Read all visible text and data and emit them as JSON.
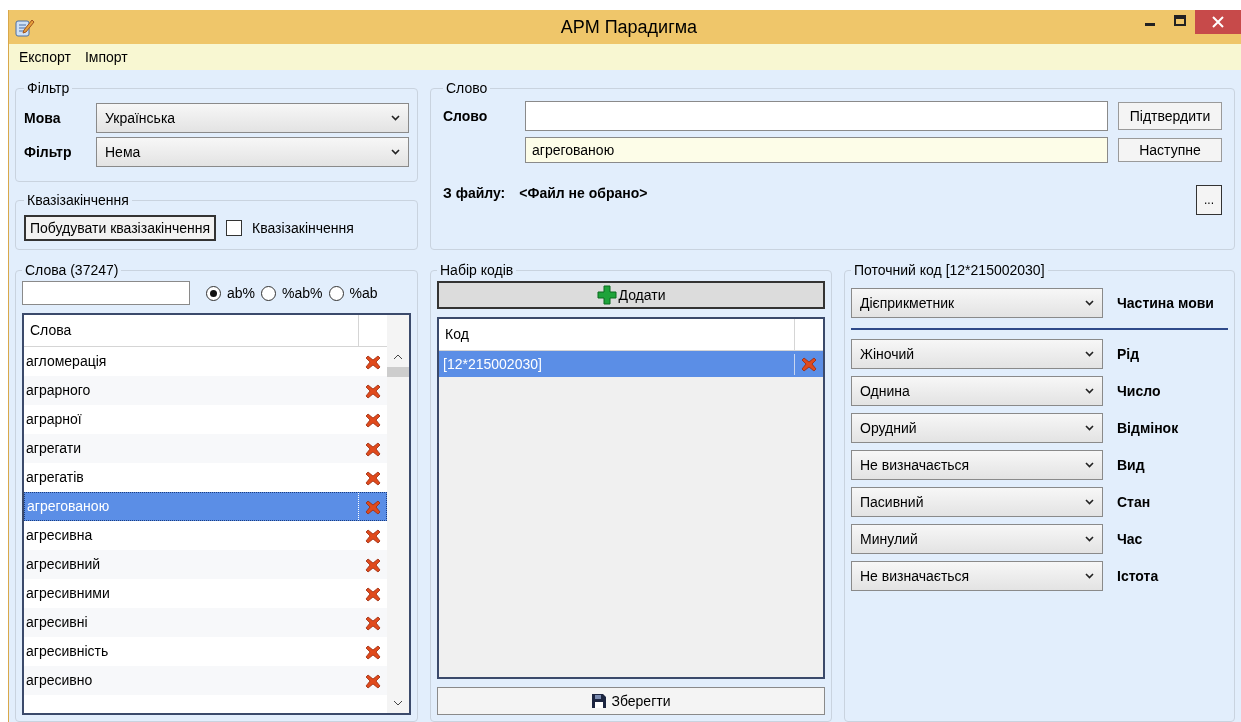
{
  "window": {
    "title": "АРМ Парадигма"
  },
  "menu": [
    "Експорт",
    "Імпорт"
  ],
  "filter_group": {
    "title": "Фільтр",
    "fields": [
      {
        "label": "Мова",
        "value": "Українська"
      },
      {
        "label": "Фільтр",
        "value": "Нема"
      }
    ]
  },
  "quasi_group": {
    "title": "Квазізакінчення",
    "button": "Побудувати квазізакінчення",
    "checkbox": {
      "label": "Квазізакінчення",
      "checked": false
    }
  },
  "word_group": {
    "title": "Слово",
    "label": "Слово",
    "confirm_button": "Підтвердити",
    "next_value": "агрегованою",
    "next_button": "Наступне",
    "file_label": "З файлу:",
    "file_value": "<Файл не обрано>",
    "browse_button": "..."
  },
  "words_group": {
    "title": "Слова (37247)",
    "search_modes": [
      {
        "label": "ab%",
        "selected": true
      },
      {
        "label": "%ab%",
        "selected": false
      },
      {
        "label": "%ab",
        "selected": false
      }
    ],
    "column": "Слова",
    "rows": [
      {
        "word": "агломерація",
        "selected": false
      },
      {
        "word": "аграрного",
        "selected": false
      },
      {
        "word": "аграрної",
        "selected": false
      },
      {
        "word": "агрегати",
        "selected": false
      },
      {
        "word": "агрегатів",
        "selected": false
      },
      {
        "word": "агрегованою",
        "selected": true
      },
      {
        "word": "агресивна",
        "selected": false
      },
      {
        "word": "агресивний",
        "selected": false
      },
      {
        "word": "агресивними",
        "selected": false
      },
      {
        "word": "агресивні",
        "selected": false
      },
      {
        "word": "агресивність",
        "selected": false
      },
      {
        "word": "агресивно",
        "selected": false
      }
    ]
  },
  "codes_group": {
    "title": "Набір кодів",
    "add_button": "Додати",
    "column": "Код",
    "rows": [
      {
        "code": "[12*215002030]",
        "selected": true
      }
    ],
    "save_button": "Зберегти"
  },
  "current_code": {
    "title": "Поточний код [12*215002030]",
    "fields": [
      {
        "kind": "main",
        "value": "Дієприкметник",
        "label": "Частина мови"
      },
      {
        "kind": "attribute",
        "value": "Жіночий",
        "label": "Рід"
      },
      {
        "kind": "attribute",
        "value": "Однина",
        "label": "Число"
      },
      {
        "kind": "attribute",
        "value": "Орудний",
        "label": "Відмінок"
      },
      {
        "kind": "attribute",
        "value": "Не визначається",
        "label": "Вид"
      },
      {
        "kind": "attribute",
        "value": "Пасивний",
        "label": "Стан"
      },
      {
        "kind": "attribute",
        "value": "Минулий",
        "label": "Час"
      },
      {
        "kind": "attribute",
        "value": "Не визначається",
        "label": "Істота"
      }
    ]
  }
}
